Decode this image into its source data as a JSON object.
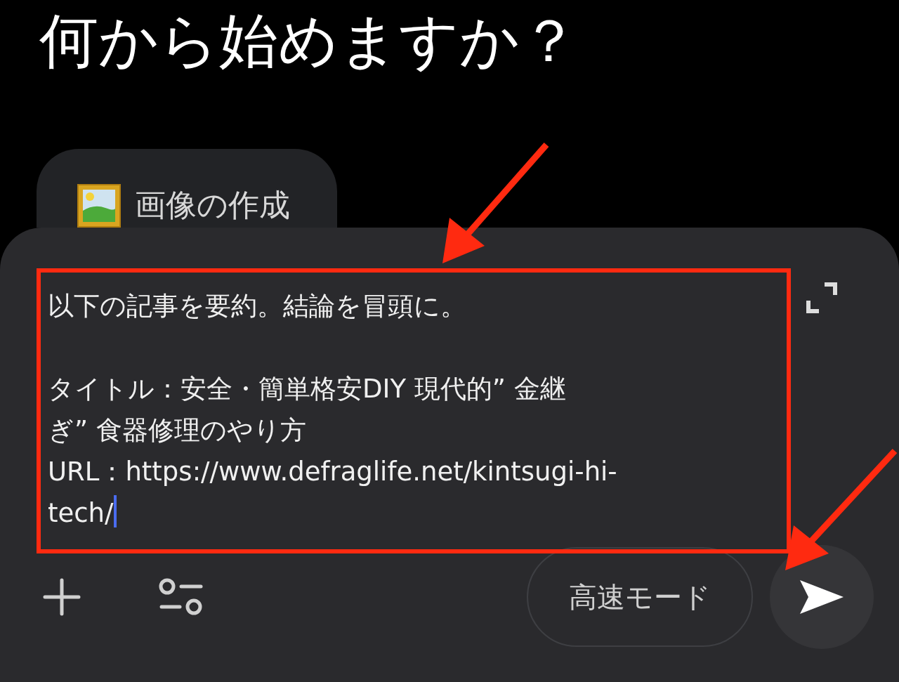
{
  "heading": "何から始めますか？",
  "suggestion_chip": {
    "label": "画像の作成"
  },
  "composer": {
    "lines": [
      "以下の記事を要約。結論を冒頭に。",
      "タイトル：安全・簡単格安DIY 現代的” 金継ぎ” 食器修理のやり方",
      "URL：https://www.defraglife.net/kintsugi-hi-tech/"
    ],
    "mode_button": "高速モード"
  }
}
